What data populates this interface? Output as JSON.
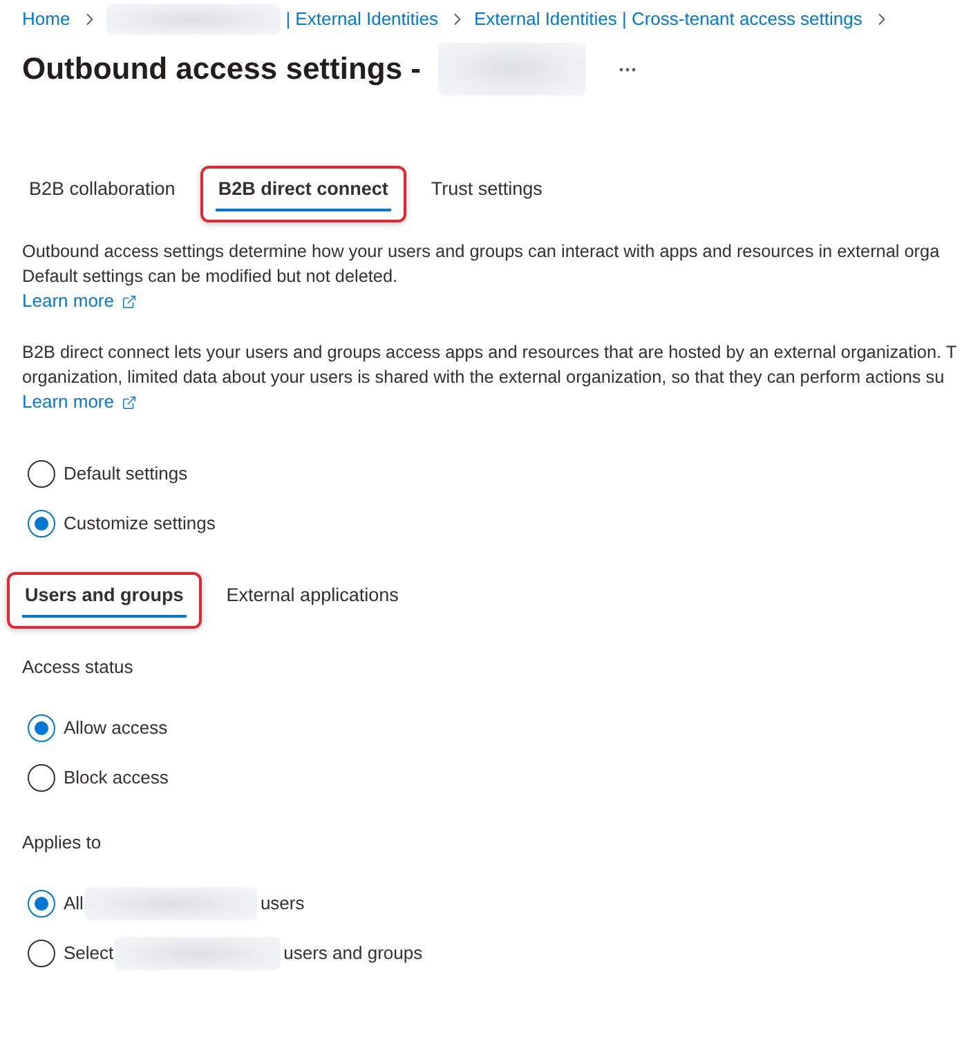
{
  "breadcrumb": [
    {
      "label": "Home",
      "redacted_prefix": false
    },
    {
      "label": "| External Identities",
      "redacted_prefix": true
    },
    {
      "label": "External Identities | Cross-tenant access settings",
      "redacted_prefix": false
    }
  ],
  "page": {
    "title": "Outbound access settings -",
    "title_redacted": true
  },
  "tabs": [
    {
      "label": "B2B collaboration",
      "selected": false,
      "annotated": false
    },
    {
      "label": "B2B direct connect",
      "selected": true,
      "annotated": true
    },
    {
      "label": "Trust settings",
      "selected": false,
      "annotated": false
    }
  ],
  "descriptions": [
    {
      "lines": [
        "Outbound access settings determine how your users and groups can interact with apps and resources in external orga",
        "Default settings can be modified but not deleted."
      ],
      "link": "Learn more"
    },
    {
      "lines": [
        "B2B direct connect lets your users and groups access apps and resources that are hosted by an external organization. T",
        "organization, limited data about your users is shared with the external organization, so that they can perform actions su"
      ],
      "link": "Learn more"
    }
  ],
  "settings_mode": {
    "options": [
      {
        "label": "Default settings",
        "selected": false
      },
      {
        "label": "Customize settings",
        "selected": true
      }
    ]
  },
  "sub_tabs": [
    {
      "label": "Users and groups",
      "selected": true,
      "annotated": true
    },
    {
      "label": "External applications",
      "selected": false,
      "annotated": false
    }
  ],
  "access_status": {
    "heading": "Access status",
    "options": [
      {
        "label": "Allow access",
        "selected": true
      },
      {
        "label": "Block access",
        "selected": false
      }
    ]
  },
  "applies_to": {
    "heading": "Applies to",
    "options": [
      {
        "label": "All",
        "redacted": true,
        "label_end": "users",
        "selected": true
      },
      {
        "label": "Select",
        "redacted": true,
        "label_end": "users and groups",
        "selected": false
      }
    ]
  }
}
